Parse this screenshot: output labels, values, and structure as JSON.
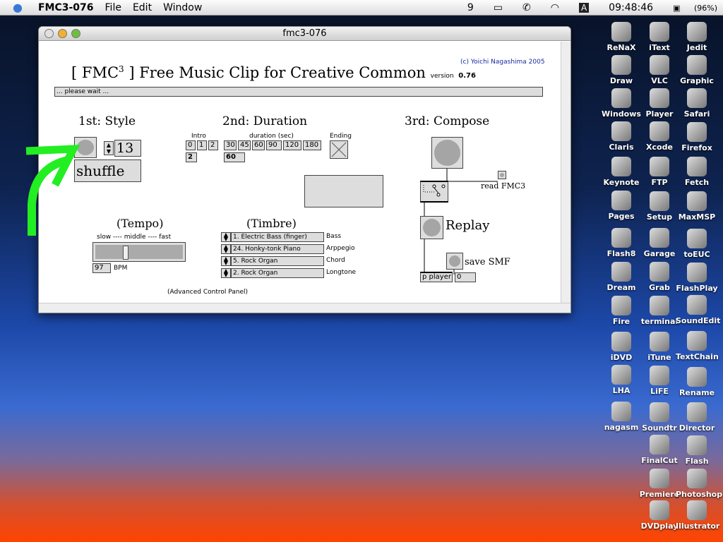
{
  "menubar": {
    "app": "FMC3-076",
    "items": [
      "File",
      "Edit",
      "Window"
    ],
    "status": {
      "clock": "09:48:46",
      "battery": "(96%)",
      "input": "A",
      "nine": "9"
    }
  },
  "window": {
    "title": "fmc3-076"
  },
  "patch": {
    "credit": "(c) Yoichi Nagashima 2005",
    "title_pre": "[ FMC",
    "title_sup": "3",
    "title_post": " ] Free Music Clip for Creative Common",
    "version_label": "version",
    "version": "0.76",
    "status": "... please wait ...",
    "style": {
      "heading": "1st: Style",
      "number": "13",
      "mode": "shuffle"
    },
    "duration": {
      "heading": "2nd: Duration",
      "intro_label": "Intro",
      "intro_options": [
        "0",
        "1",
        "2"
      ],
      "intro_value": "2",
      "duration_label": "duration (sec)",
      "duration_options": [
        "30",
        "45",
        "60",
        "90",
        "120",
        "180"
      ],
      "duration_value": "60",
      "ending_label": "Ending"
    },
    "compose": {
      "heading": "3rd: Compose",
      "read_label": "read FMC3",
      "replay_label": "Replay",
      "save_label": "save SMF",
      "player": "p player",
      "counter": "0"
    },
    "tempo": {
      "heading": "(Tempo)",
      "scale": "slow ---- middle ---- fast",
      "bpm": "97",
      "bpm_unit": "BPM",
      "slider_fraction": 0.32
    },
    "timbre": {
      "heading": "(Timbre)",
      "rows": [
        {
          "instrument": "1. Electric Bass (finger)",
          "part": "Bass"
        },
        {
          "instrument": "24. Honky-tonk Piano",
          "part": "Arppegio"
        },
        {
          "instrument": "5. Rock Organ",
          "part": "Chord"
        },
        {
          "instrument": "2. Rock Organ",
          "part": "Longtone"
        }
      ]
    },
    "advanced": "(Advanced Control Panel)"
  },
  "annotation": {
    "arrow_color": "#22ee22"
  },
  "desktop": {
    "icons": [
      "ReNaX",
      "iText",
      "Jedit",
      "Draw",
      "VLC",
      "Graphic",
      "Windows",
      "Player",
      "Safari",
      "Claris",
      "Xcode",
      "Firefox",
      "Keynote",
      "FTP",
      "Fetch",
      "Pages",
      "Setup",
      "MaxMSP",
      "Flash8",
      "Garage",
      "toEUC",
      "Dream",
      "Grab",
      "FlashPlay",
      "Fire",
      "terminal",
      "SoundEdit",
      "iDVD",
      "iTune",
      "TextChain",
      "LHA",
      "LiFE",
      "Rename",
      "nagasm",
      "Soundtr",
      "Director",
      "FinalCut",
      "Flash",
      "Premiere",
      "Photoshop",
      "DVDplay",
      "Illustrator"
    ]
  }
}
